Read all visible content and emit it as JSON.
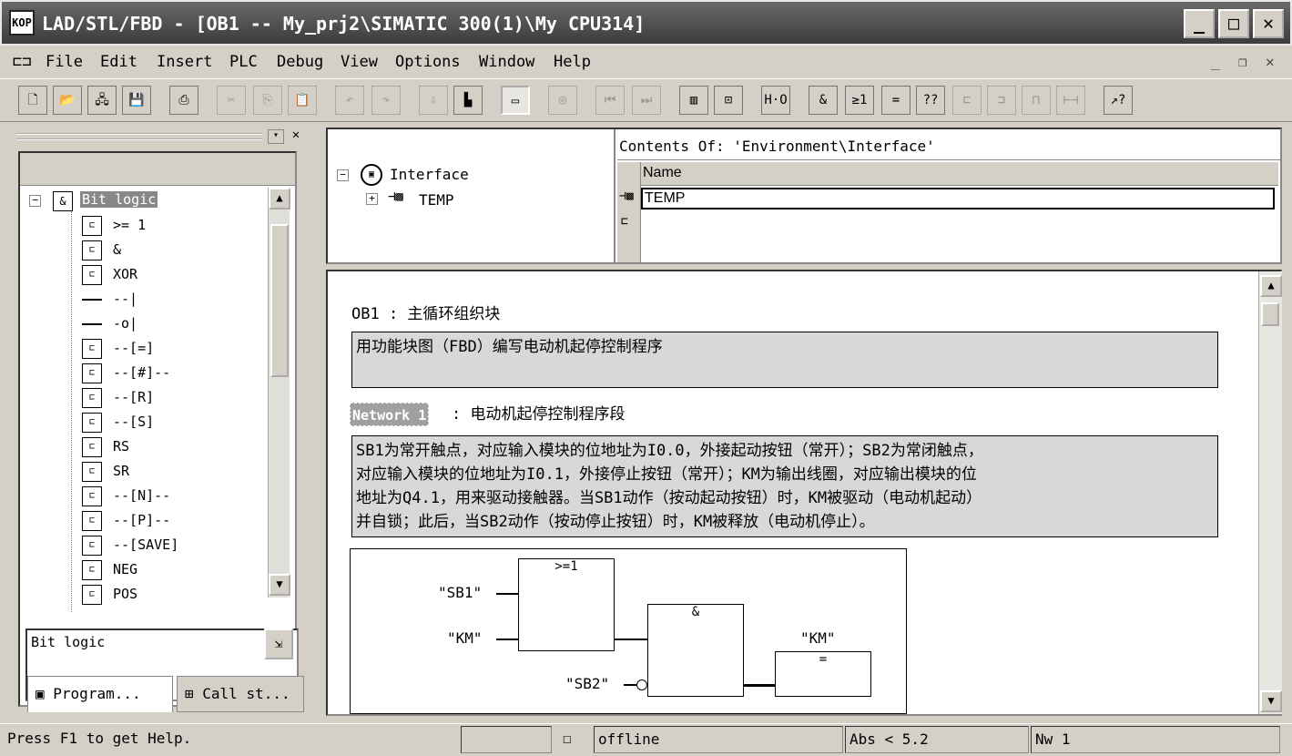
{
  "window": {
    "title": "LAD/STL/FBD  - [OB1 -- My_prj2\\SIMATIC 300(1)\\My CPU314]"
  },
  "menu": {
    "items": [
      "File",
      "Edit",
      "Insert",
      "PLC",
      "Debug",
      "View",
      "Options",
      "Window",
      "Help"
    ]
  },
  "toolbar": {
    "buttons": [
      "new-icon",
      "open-icon",
      "accessible-nodes-icon",
      "save-icon",
      "print-icon",
      "cut-icon",
      "copy-icon",
      "paste-icon",
      "undo-icon",
      "redo-icon",
      "download-icon",
      "monitor-icon",
      "overview-icon",
      "display-icon",
      "first-network-icon",
      "last-network-icon",
      "ladder-icon",
      "fbd-icon",
      "stl-icon",
      "and-box-icon",
      "ge1-box-icon",
      "assign-box-icon",
      "empty-box-icon",
      "branch-open-icon",
      "branch-close-icon",
      "contact-icon",
      "coil-icon",
      "help-pointer-icon"
    ],
    "network_button": "H·O",
    "and_button": "&",
    "or_button": "≥1",
    "assign_button": "=",
    "empty_button": "??",
    "help_button": "↗?"
  },
  "program_elements": {
    "root": "Bit logic",
    "items": [
      ">= 1",
      "&",
      "XOR",
      "--|",
      "-o|",
      "--[=]",
      "--[#]--",
      "--[R]",
      "--[S]",
      "RS",
      "SR",
      "--[N]--",
      "--[P]--",
      "--[SAVE]",
      "NEG",
      "POS"
    ],
    "description": "Bit logic",
    "tabs": [
      "Program...",
      "Call st..."
    ]
  },
  "interface": {
    "tree_root": "Interface",
    "tree_child": "TEMP",
    "contents_of": "Contents Of: 'Environment\\Interface'",
    "column_name": "Name",
    "rows": [
      "TEMP"
    ]
  },
  "code": {
    "block_title": "OB1 : 主循环组织块",
    "block_comment": "用功能块图（FBD）编写电动机起停控制程序",
    "network_label": "Network 1",
    "network_title": ": 电动机起停控制程序段",
    "network_comment_lines": [
      "SB1为常开触点，对应输入模块的位地址为I0.0，外接起动按钮（常开）；SB2为常闭触点，",
      "对应输入模块的位地址为I0.1，外接停止按钮（常开）；KM为输出线圈，对应输出模块的位",
      "地址为Q4.1，用来驱动接触器。当SB1动作（按动起动按钮）时，KM被驱动（电动机起动）",
      "并自锁；此后，当SB2动作（按动停止按钮）时，KM被释放（电动机停止）。"
    ],
    "fbd": {
      "or_box": ">=1",
      "and_box": "&",
      "assign_box": "=",
      "input_sb1": "\"SB1\"",
      "input_km": "\"KM\"",
      "input_sb2": "\"SB2\"",
      "output_km": "\"KM\""
    }
  },
  "status": {
    "help": "Press F1 to get Help.",
    "mode": "offline",
    "abs": "Abs < 5.2",
    "nw": "Nw 1"
  }
}
